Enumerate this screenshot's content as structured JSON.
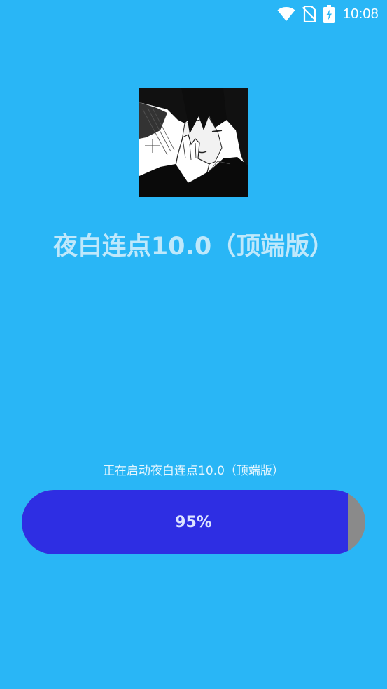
{
  "status_bar": {
    "time": "10:08",
    "icons": [
      "wifi-icon",
      "no-sim-icon",
      "battery-charging-icon"
    ]
  },
  "splash": {
    "app_icon": "avatar-image",
    "app_title": "夜白连点10.0（顶端版）",
    "loading_text": "正在启动夜白连点10.0（顶端版）"
  },
  "progress": {
    "value": 0.95,
    "label": "95%"
  },
  "colors": {
    "background": "#29b6f6",
    "progress_fill": "#2e2ee3",
    "progress_track": "#8a8a8a",
    "title_text": "#bfe8fb"
  }
}
